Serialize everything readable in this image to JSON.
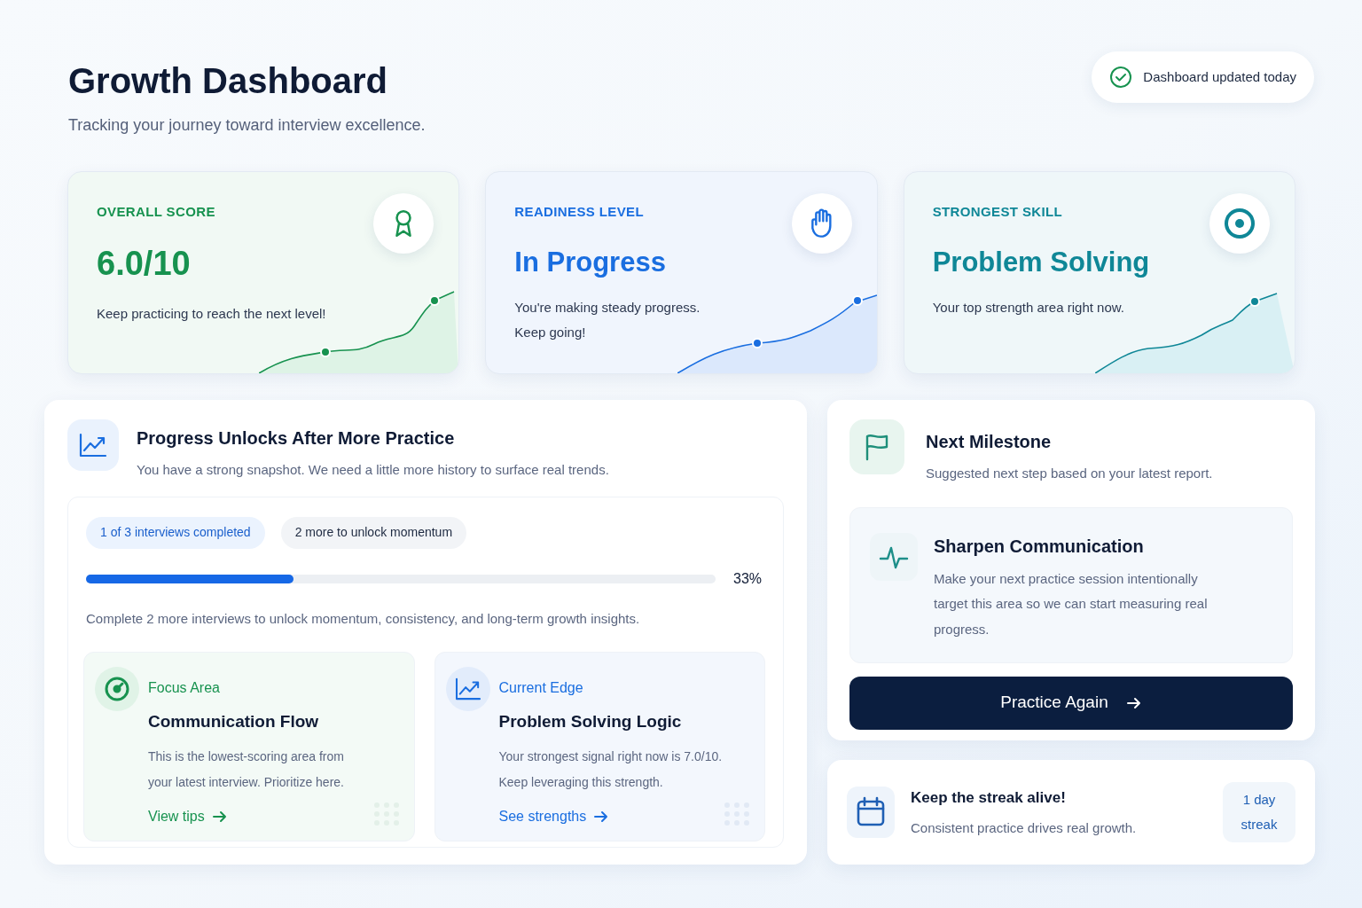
{
  "header": {
    "title": "Growth Dashboard",
    "subtitle": "Tracking your journey toward interview excellence.",
    "status": "Dashboard updated today"
  },
  "stat_cards": [
    {
      "label": "OVERALL SCORE",
      "value": "6.0/10",
      "lines": [
        "Keep practicing to reach the next level!"
      ],
      "color": "#17924f"
    },
    {
      "label": "READINESS LEVEL",
      "value": "In Progress",
      "lines": [
        "You're making steady progress.",
        "Keep going!"
      ],
      "color": "#1a6ee0"
    },
    {
      "label": "STRONGEST SKILL",
      "value": "Problem Solving",
      "lines": [
        "Your top strength area right now."
      ],
      "color": "#0f8797"
    }
  ],
  "progress_panel": {
    "title": "Progress Unlocks After More Practice",
    "subtitle": "You have a strong snapshot. We need a little more history to surface real trends.",
    "pills": [
      "1 of 3 interviews completed",
      "2 more to unlock momentum"
    ],
    "level": 0.33,
    "percent": "33%",
    "note": "Complete 2 more interviews to unlock momentum, consistency, and long-term growth insights.",
    "cards": [
      {
        "eyebrow": "Focus Area",
        "title": "Communication Flow",
        "lines": [
          "This is the lowest-scoring area from",
          "your latest interview. Prioritize here."
        ],
        "link": "View tips",
        "color": "#17924f"
      },
      {
        "eyebrow": "Current Edge",
        "title": "Problem Solving Logic",
        "lines": [
          "Your strongest signal right now is 7.0/10.",
          "Keep leveraging this strength."
        ],
        "link": "See strengths",
        "color": "#1a6ee0"
      }
    ]
  },
  "milestone": {
    "title": "Next Milestone",
    "subtitle": "Suggested next step based on your latest report.",
    "item_title": "Sharpen Communication",
    "item_text": "Make your next practice session intentionally target this area so we can start measuring real progress.",
    "button": "Practice Again"
  },
  "streak": {
    "title": "Keep the streak alive!",
    "text": "Consistent practice drives real growth.",
    "badge": "1 day streak"
  }
}
